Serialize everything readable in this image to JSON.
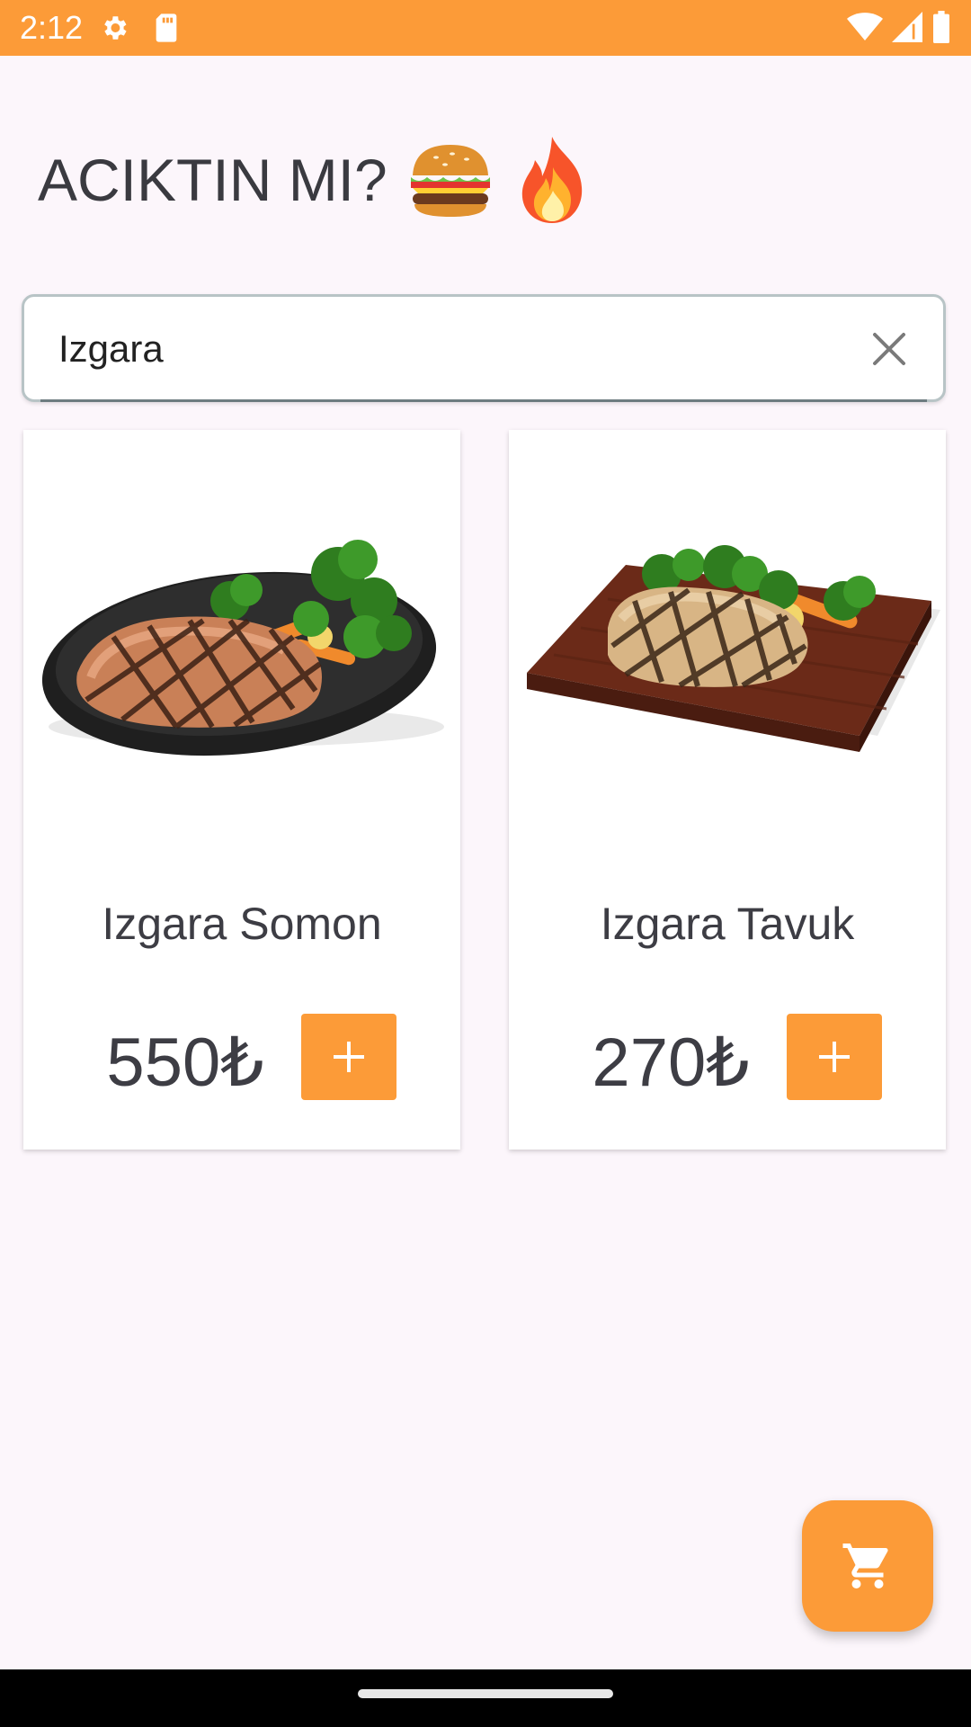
{
  "status_bar": {
    "time": "2:12",
    "left_icons": [
      "gear-icon",
      "sd-card-icon"
    ],
    "right_icons": [
      "wifi-icon",
      "signal-icon",
      "battery-icon"
    ]
  },
  "header": {
    "title": "ACIKTIN MI?",
    "emojis": [
      "burger-emoji",
      "fire-emoji"
    ]
  },
  "search": {
    "value": "Izgara",
    "clear_icon": "close-icon"
  },
  "products": [
    {
      "name": "Izgara Somon",
      "price": "550₺",
      "image": "grilled-salmon-image",
      "add_icon": "plus-icon"
    },
    {
      "name": "Izgara Tavuk",
      "price": "270₺",
      "image": "grilled-chicken-image",
      "add_icon": "plus-icon"
    }
  ],
  "fab": {
    "icon": "cart-icon"
  },
  "colors": {
    "accent": "#fc9b38",
    "background": "#fcf6fb",
    "text": "#3d3d44"
  }
}
